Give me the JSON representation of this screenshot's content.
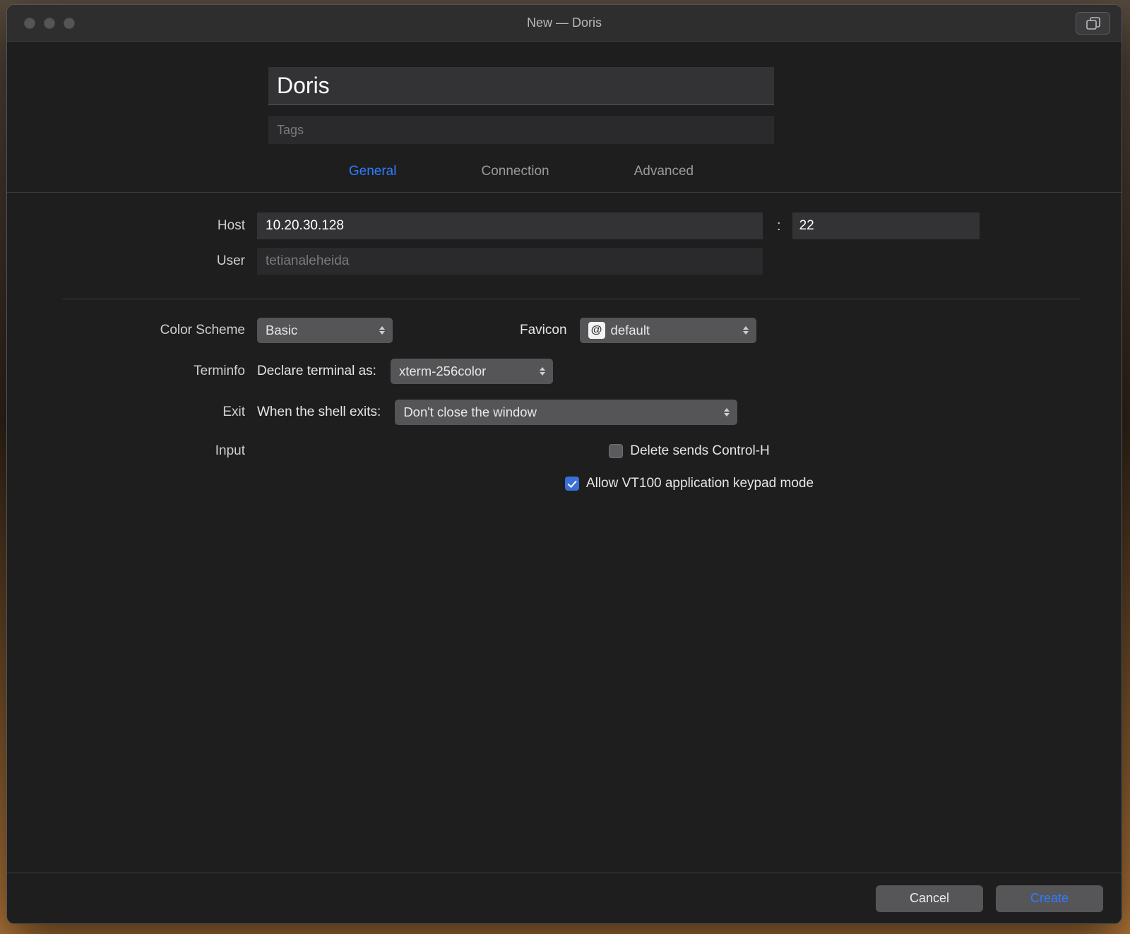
{
  "window": {
    "title": "New — Doris"
  },
  "header": {
    "name_value": "Doris",
    "tags_placeholder": "Tags"
  },
  "tabs": {
    "general": "General",
    "connection": "Connection",
    "advanced": "Advanced",
    "active": "general"
  },
  "connection": {
    "host_label": "Host",
    "host_value": "10.20.30.128",
    "port_sep": ":",
    "port_value": "22",
    "user_label": "User",
    "user_placeholder": "tetianaleheida"
  },
  "settings": {
    "color_scheme_label": "Color Scheme",
    "color_scheme_value": "Basic",
    "favicon_label": "Favicon",
    "favicon_chip": "@",
    "favicon_value": "default",
    "terminfo_label": "Terminfo",
    "terminfo_prefix": "Declare terminal as:",
    "terminfo_value": "xterm-256color",
    "exit_label": "Exit",
    "exit_prefix": "When the shell exits:",
    "exit_value": "Don't close the window",
    "input_label": "Input",
    "delete_ctrl_h_checked": false,
    "delete_ctrl_h_label": "Delete sends Control-H",
    "vt100_checked": true,
    "vt100_label": "Allow VT100 application keypad mode"
  },
  "footer": {
    "cancel": "Cancel",
    "create": "Create"
  }
}
